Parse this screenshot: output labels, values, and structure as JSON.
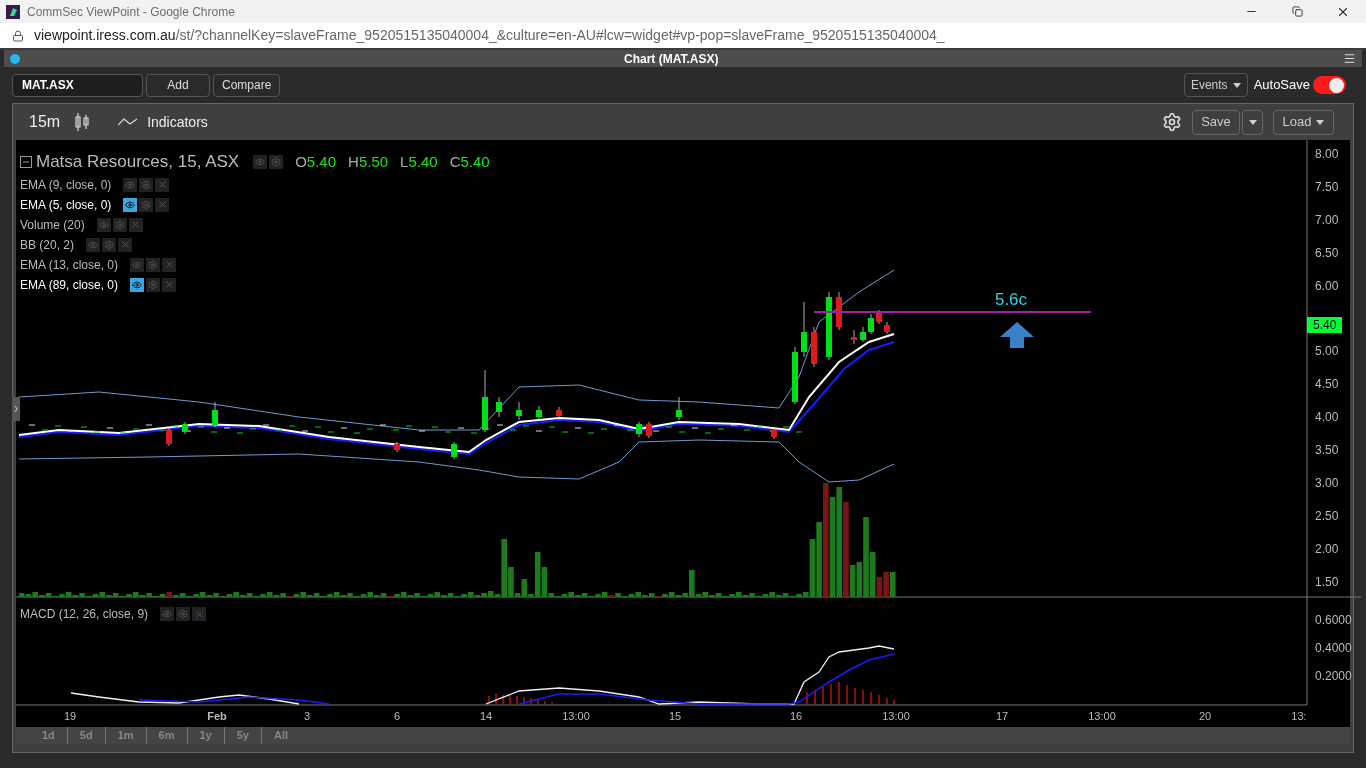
{
  "browser": {
    "title": "CommSec ViewPoint - Google Chrome",
    "url_host": "viewpoint.iress.com.au",
    "url_path": "/st/?channelKey=slaveFrame_9520515135040004_&culture=en-AU#lcw=widget#vp-pop=slaveFrame_9520515135040004_"
  },
  "panel": {
    "title": "Chart (MAT.ASX)"
  },
  "toolbar": {
    "symbol": "MAT.ASX",
    "buttons": [
      "Add",
      "Compare"
    ],
    "events": "Events",
    "autosave": {
      "label": "AutoSave",
      "on": true
    }
  },
  "chart_toolbar": {
    "interval": "15m",
    "indicators": "Indicators",
    "save": "Save",
    "load": "Load"
  },
  "legend": {
    "title": "Matsa Resources, 15, ASX",
    "ohlc": [
      {
        "key": "O",
        "value": "5.40"
      },
      {
        "key": "H",
        "value": "5.50"
      },
      {
        "key": "L",
        "value": "5.40"
      },
      {
        "key": "C",
        "value": "5.40"
      }
    ]
  },
  "studies": [
    {
      "label": "EMA (9, close, 0)",
      "visible": false
    },
    {
      "label": "EMA (5, close, 0)",
      "visible": true
    },
    {
      "label": "Volume (20)",
      "visible": false
    },
    {
      "label": "BB (20, 2)",
      "visible": false
    },
    {
      "label": "EMA (13, close, 0)",
      "visible": false
    },
    {
      "label": "EMA (89, close, 0)",
      "visible": true
    }
  ],
  "annotation": "5.6c",
  "price_axis": [
    "8.00",
    "7.50",
    "7.00",
    "6.50",
    "6.00",
    "5.00",
    "4.50",
    "4.00",
    "3.50",
    "3.00",
    "2.50",
    "2.00",
    "1.50"
  ],
  "last_price": "5.40",
  "macd": {
    "label": "MACD (12, 26, close, 9)",
    "axis": [
      "0.6000",
      "0.4000",
      "0.2000"
    ]
  },
  "time_axis": [
    "19",
    "Feb",
    "3",
    "6",
    "14",
    "13:00",
    "15",
    "16",
    "13:00",
    "17",
    "13:00",
    "20",
    "13:"
  ],
  "ranges": [
    "1d",
    "5d",
    "1m",
    "6m",
    "1y",
    "5y",
    "All"
  ]
}
